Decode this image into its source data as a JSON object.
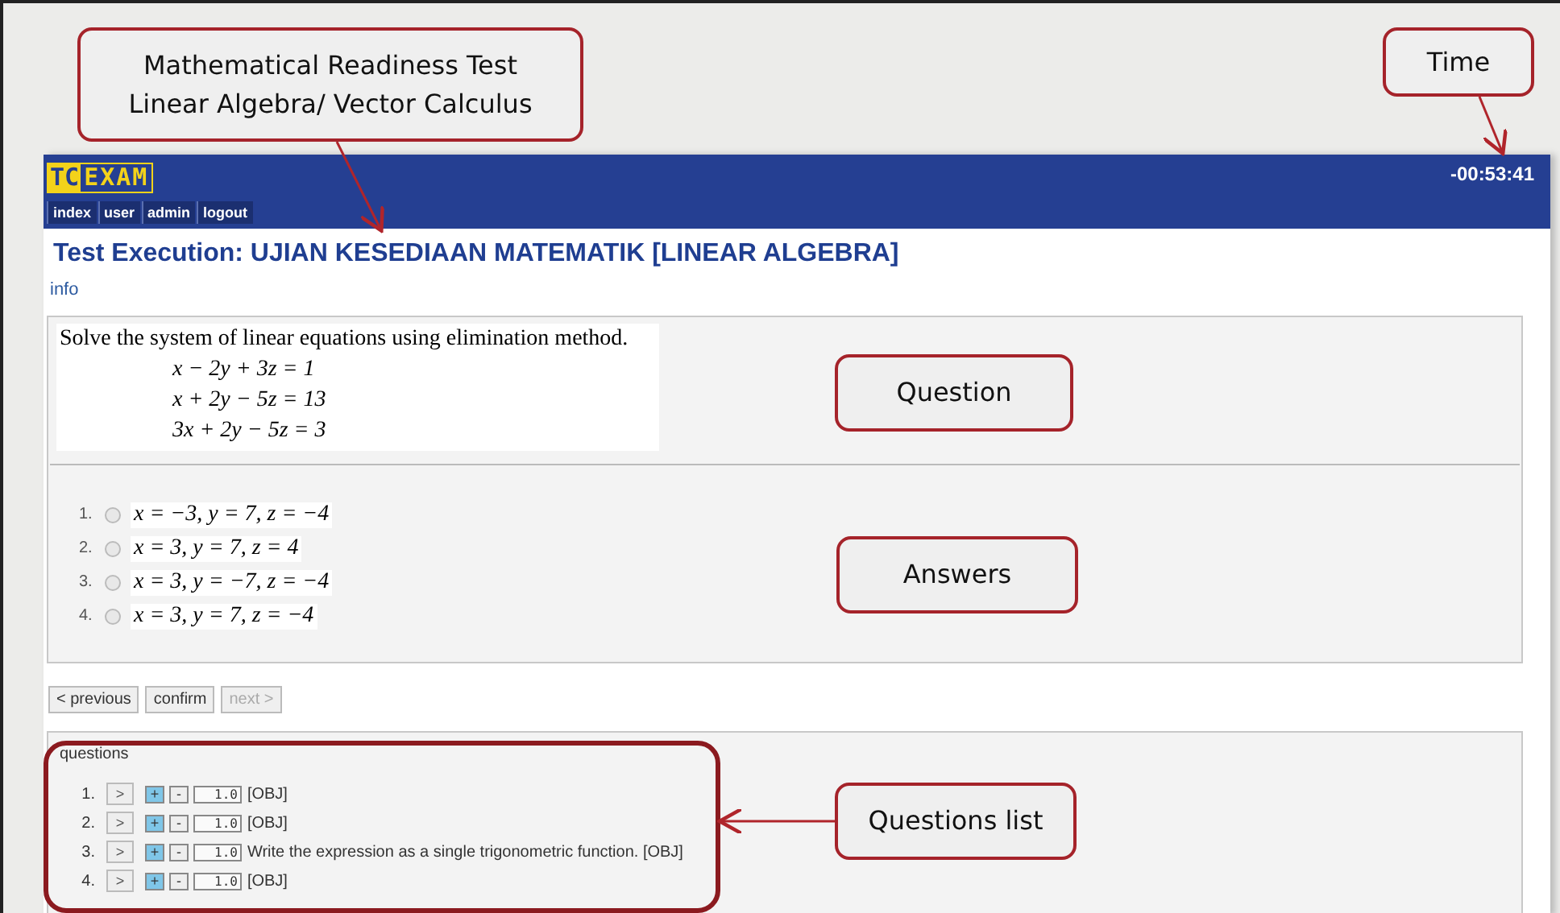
{
  "app": {
    "logo": [
      "TC",
      "EXAM"
    ],
    "timer": "-00:53:41",
    "nav": [
      "index",
      "user",
      "admin",
      "logout"
    ],
    "title": "Test Execution: UJIAN KESEDIAAN MATEMATIK [LINEAR ALGEBRA]",
    "info_link": "info"
  },
  "question": {
    "prompt": "Solve the system of linear equations using elimination method.",
    "equations": [
      "x − 2y + 3z = 1",
      "x + 2y − 5z = 13",
      "3x + 2y − 5z = 3"
    ]
  },
  "answers": [
    {
      "number": "1.",
      "text": "x = −3, y = 7, z = −4",
      "selected": false
    },
    {
      "number": "2.",
      "text": "x = 3, y = 7, z = 4",
      "selected": false
    },
    {
      "number": "3.",
      "text": "x = 3, y = −7, z = −4",
      "selected": false
    },
    {
      "number": "4.",
      "text": "x = 3, y = 7, z = −4",
      "selected": false
    }
  ],
  "buttons": [
    {
      "label": "< previous",
      "disabled": false
    },
    {
      "label": "confirm",
      "disabled": false
    },
    {
      "label": "next >",
      "disabled": true
    }
  ],
  "questions_list": {
    "title": "questions",
    "items": [
      {
        "number": "1.",
        "open": ">",
        "plus": "+",
        "minus": "-",
        "weight": "1.0",
        "text": "[OBJ]"
      },
      {
        "number": "2.",
        "open": ">",
        "plus": "+",
        "minus": "-",
        "weight": "1.0",
        "text": "[OBJ]"
      },
      {
        "number": "3.",
        "open": ">",
        "plus": "+",
        "minus": "-",
        "weight": "1.0",
        "text": "Write the expression as a single trigonometric function. [OBJ]"
      },
      {
        "number": "4.",
        "open": ">",
        "plus": "+",
        "minus": "-",
        "weight": "1.0",
        "text": "[OBJ]"
      }
    ]
  },
  "callouts": [
    {
      "lines": [
        "Mathematical Readiness Test",
        "Linear Algebra/ Vector Calculus"
      ]
    },
    {
      "lines": [
        "Time"
      ]
    },
    {
      "lines": [
        "Question"
      ]
    },
    {
      "lines": [
        "Answers"
      ]
    },
    {
      "lines": [
        "Questions list"
      ]
    }
  ]
}
